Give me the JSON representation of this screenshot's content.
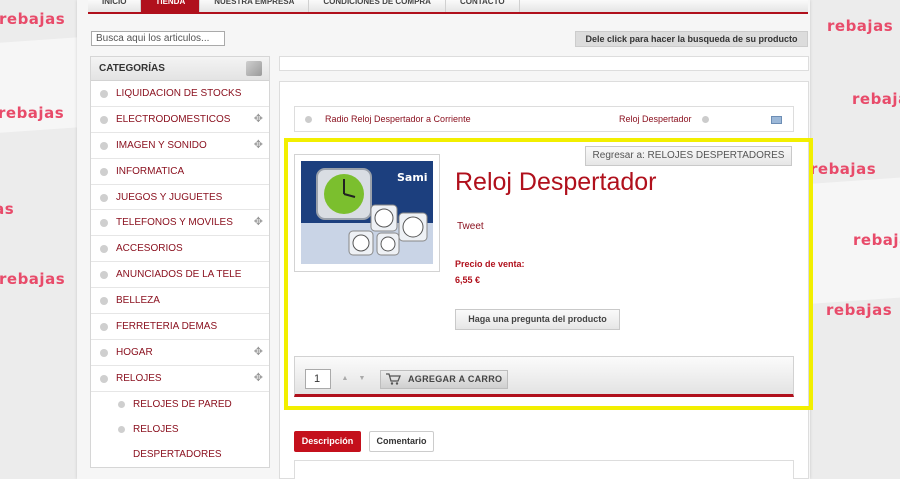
{
  "background": {
    "promo_word": "rebajas",
    "accent_color": "#e84b6a"
  },
  "nav": {
    "tabs": [
      "INICIO",
      "TIENDA",
      "NUESTRA EMPRESA",
      "CONDICIONES DE COMPRA",
      "CONTACTO"
    ],
    "active_index": 1
  },
  "search": {
    "placeholder": "Busca aqui los articulos...",
    "hint": "Dele click para hacer la busqueda de su producto"
  },
  "sidebar": {
    "title": "CATEGORÍAS",
    "items": [
      {
        "label": "LIQUIDACION DE STOCKS",
        "expandable": false
      },
      {
        "label": "ELECTRODOMESTICOS",
        "expandable": true
      },
      {
        "label": "IMAGEN Y SONIDO",
        "expandable": true
      },
      {
        "label": "INFORMATICA",
        "expandable": false
      },
      {
        "label": "JUEGOS Y JUGUETES",
        "expandable": false
      },
      {
        "label": "TELEFONOS Y MOVILES",
        "expandable": true
      },
      {
        "label": "ACCESORIOS",
        "expandable": false
      },
      {
        "label": "ANUNCIADOS DE LA TELE",
        "expandable": false
      },
      {
        "label": "BELLEZA",
        "expandable": false
      },
      {
        "label": "FERRETERIA DEMAS",
        "expandable": false
      },
      {
        "label": "HOGAR",
        "expandable": true
      },
      {
        "label": "RELOJES",
        "expandable": true
      }
    ],
    "subitems": [
      "RELOJES DE PARED",
      "RELOJES",
      "DESPERTADORES"
    ]
  },
  "breadcrumb": {
    "prev": "Radio Reloj Despertador a Corriente",
    "next": "Reloj Despertador"
  },
  "product": {
    "back_label": "Regresar a: RELOJES DESPERTADORES",
    "brand": "Sami",
    "title": "Reloj Despertador",
    "tweet": "Tweet",
    "price_label": "Precio de venta:",
    "price": "6,55 €",
    "ask_label": "Haga una pregunta del producto",
    "quantity": "1",
    "add_to_cart": "AGREGAR A CARRO"
  },
  "tabs": {
    "description": "Descripción",
    "comments": "Comentario"
  },
  "colors": {
    "brand_red": "#b0101c",
    "highlight": "#f2ef00"
  }
}
